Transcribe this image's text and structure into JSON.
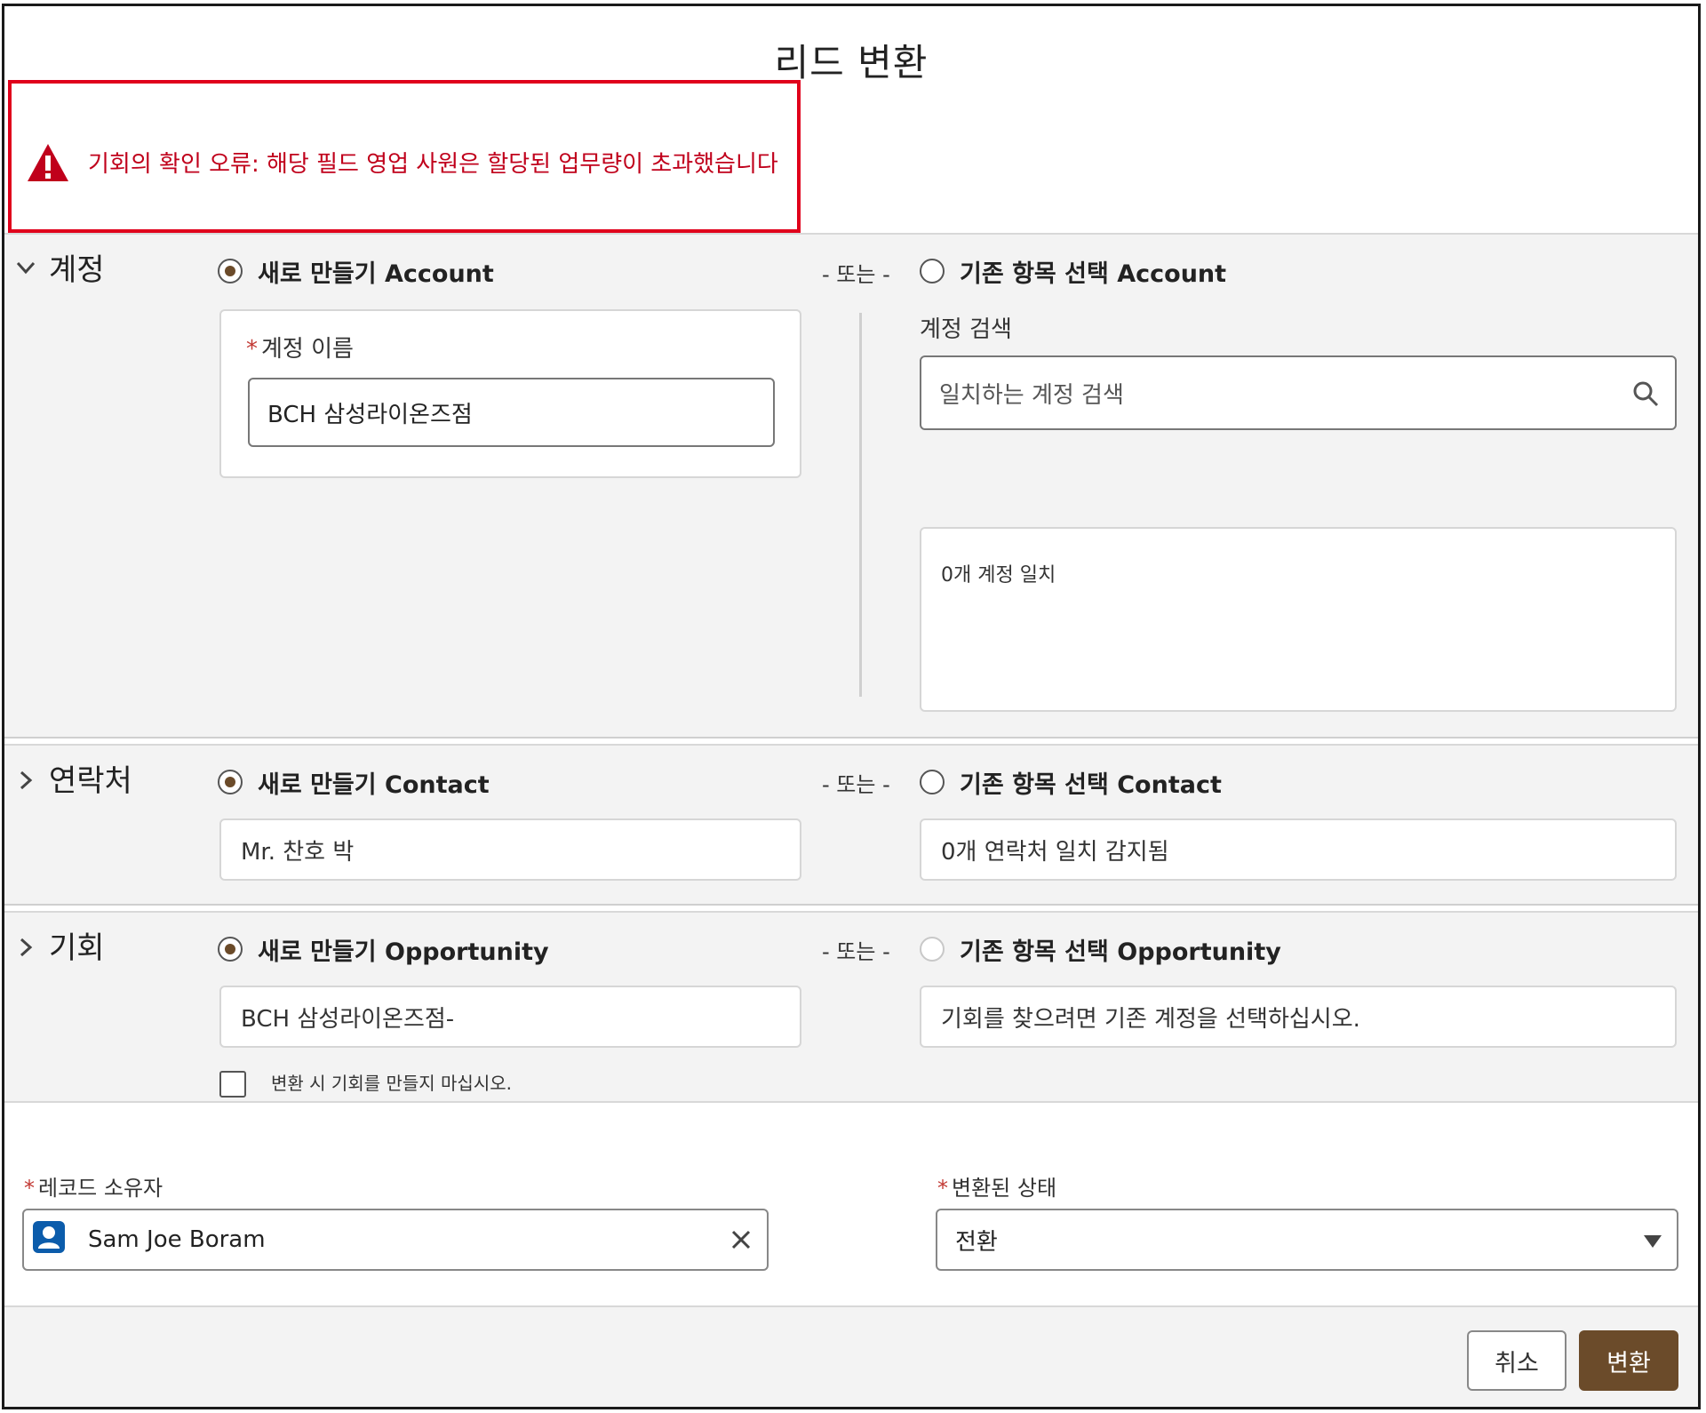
{
  "dialog": {
    "title": "리드 변환"
  },
  "error": {
    "message": "기회의 확인 오류: 해당 필드 영업 사원은 할당된 업무량이 초과했습니다"
  },
  "or_label": "- 또는 -",
  "account": {
    "section_label": "계정",
    "new_option": "새로 만들기 Account",
    "existing_option": "기존 항목 선택 Account",
    "name_label": "계정 이름",
    "name_value": "BCH 삼성라이온즈점",
    "search_label": "계정 검색",
    "search_placeholder": "일치하는 계정 검색",
    "match_text": "0개 계정 일치"
  },
  "contact": {
    "section_label": "연락처",
    "new_option": "새로 만들기 Contact",
    "existing_option": "기존 항목 선택 Contact",
    "new_value": "Mr. 찬호 박",
    "match_text": "0개 연락처 일치 감지됨"
  },
  "opportunity": {
    "section_label": "기회",
    "new_option": "새로 만들기 Opportunity",
    "existing_option": "기존 항목 선택 Opportunity",
    "new_value": "BCH 삼성라이온즈점-",
    "existing_hint": "기회를 찾으려면 기존 계정을 선택하십시오.",
    "dont_create_label": "변환 시 기회를 만들지 마십시오."
  },
  "owner": {
    "label": "레코드 소유자",
    "value": "Sam Joe Boram"
  },
  "status": {
    "label": "변환된 상태",
    "value": "전환"
  },
  "buttons": {
    "cancel": "취소",
    "convert": "변환"
  },
  "colors": {
    "accent": "#6b4b2a",
    "error": "#c0001b",
    "error_border": "#e0001b",
    "user_icon": "#0b5cab"
  }
}
